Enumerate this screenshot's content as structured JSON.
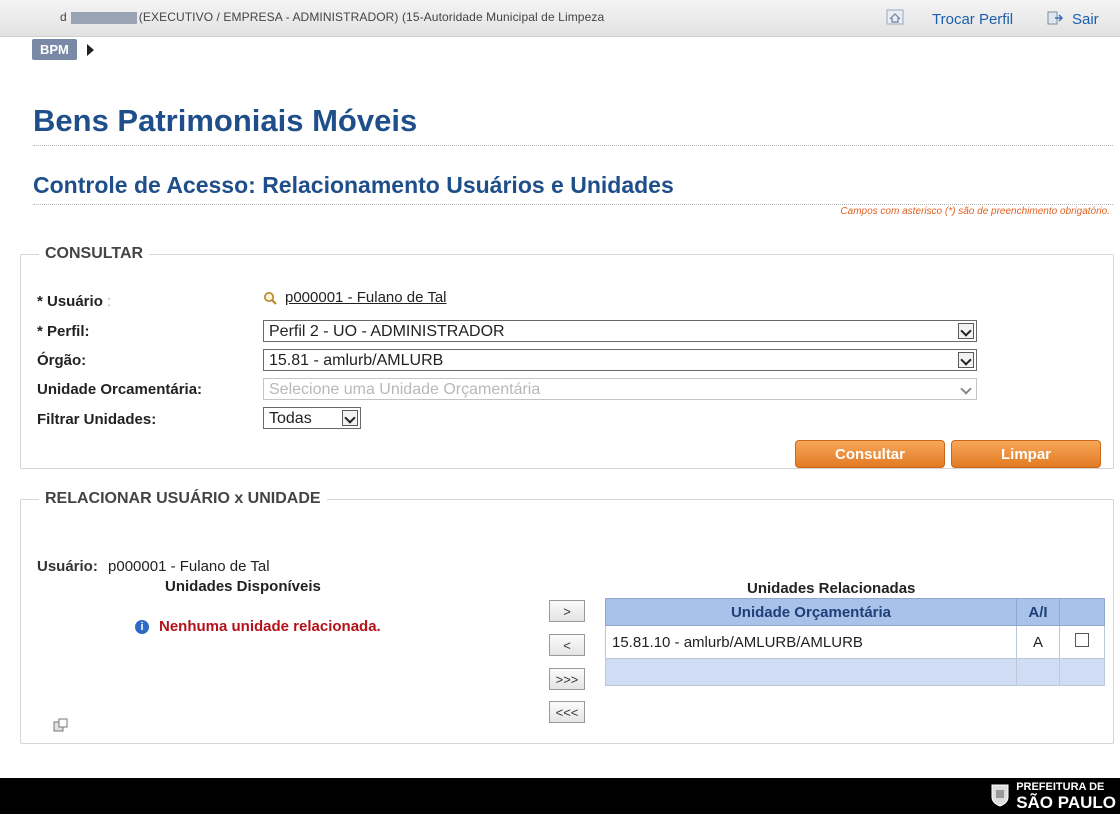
{
  "topbar": {
    "user_prefix": "d",
    "user_context": "(EXECUTIVO / EMPRESA - ADMINISTRADOR) (15-Autoridade Municipal de Limpeza",
    "trocar_perfil": "Trocar Perfil",
    "sair": "Sair"
  },
  "breadcrumb": {
    "bpm": "BPM"
  },
  "page": {
    "title": "Bens Patrimoniais Móveis",
    "subtitle": "Controle de Acesso: Relacionamento Usuários e Unidades",
    "required_note": "Campos com asterisco (*) são de preenchimento obrigatório."
  },
  "consultar": {
    "legend": "CONSULTAR",
    "usuario_label": "* Usuário",
    "usuario_value": "p000001 - Fulano de Tal",
    "perfil_label": "* Perfil:",
    "perfil_value": "Perfil 2 - UO - ADMINISTRADOR",
    "orgao_label": "Órgão:",
    "orgao_value": "15.81 - amlurb/AMLURB",
    "unidade_label": "Unidade Orcamentária:",
    "unidade_placeholder": "Selecione uma Unidade Orçamentária",
    "filtrar_label": "Filtrar Unidades:",
    "filtrar_value": "Todas",
    "btn_consultar": "Consultar",
    "btn_limpar": "Limpar"
  },
  "relacionar": {
    "legend": "RELACIONAR USUÁRIO x UNIDADE",
    "usuario_label": "Usuário:",
    "usuario_value": "p000001 - Fulano de Tal",
    "disponiveis_title": "Unidades Disponíveis",
    "empty_message": "Nenhuma unidade relacionada.",
    "relacionadas_title": "Unidades Relacionadas",
    "move_buttons": [
      ">",
      "<",
      ">>>",
      "<<<"
    ],
    "table": {
      "headers": [
        "Unidade Orçamentária",
        "A/I",
        ""
      ],
      "rows": [
        {
          "unidade": "15.81.10 - amlurb/AMLURB/AMLURB",
          "ai": "A"
        }
      ]
    }
  },
  "footer": {
    "line1": "PREFEITURA DE",
    "line2": "SÃO PAULO"
  },
  "colors": {
    "title_blue": "#1e4f8a",
    "link_blue": "#1b5fae",
    "button_orange": "#e27a22",
    "error_red": "#b3121a",
    "table_header": "#a9c2ea"
  }
}
